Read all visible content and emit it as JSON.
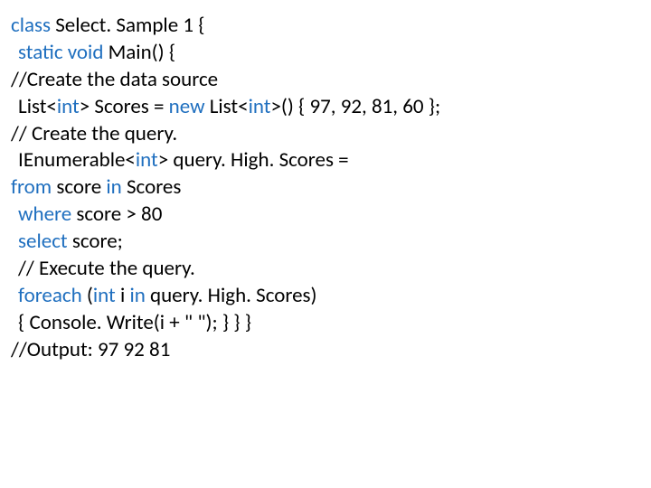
{
  "lines": [
    {
      "indent": 0,
      "tokens": [
        {
          "t": "class ",
          "c": "kw"
        },
        {
          "t": "Select. Sample 1 {",
          "c": "txt"
        }
      ]
    },
    {
      "indent": 1,
      "tokens": [
        {
          "t": "static void ",
          "c": "kw"
        },
        {
          "t": "Main() {",
          "c": "txt"
        }
      ]
    },
    {
      "indent": 0,
      "tokens": [
        {
          "t": "//Create the data source",
          "c": "txt"
        }
      ]
    },
    {
      "indent": 1,
      "tokens": [
        {
          "t": "List<",
          "c": "txt"
        },
        {
          "t": "int",
          "c": "kw"
        },
        {
          "t": "> Scores = ",
          "c": "txt"
        },
        {
          "t": "new ",
          "c": "kw"
        },
        {
          "t": "List<",
          "c": "txt"
        },
        {
          "t": "int",
          "c": "kw"
        },
        {
          "t": ">() { 97, 92, 81, 60 };",
          "c": "txt"
        }
      ]
    },
    {
      "indent": 0,
      "tokens": [
        {
          "t": "// Create the query.",
          "c": "txt"
        }
      ]
    },
    {
      "indent": 1,
      "tokens": [
        {
          "t": "IEnumerable<",
          "c": "txt"
        },
        {
          "t": "int",
          "c": "kw"
        },
        {
          "t": "> query. High. Scores =",
          "c": "txt"
        }
      ]
    },
    {
      "indent": 0,
      "tokens": [
        {
          "t": "from ",
          "c": "kw"
        },
        {
          "t": "score ",
          "c": "txt"
        },
        {
          "t": "in ",
          "c": "kw"
        },
        {
          "t": "Scores",
          "c": "txt"
        }
      ]
    },
    {
      "indent": 1,
      "tokens": [
        {
          "t": "where ",
          "c": "kw"
        },
        {
          "t": "score > 80",
          "c": "txt"
        }
      ]
    },
    {
      "indent": 1,
      "tokens": [
        {
          "t": "select ",
          "c": "kw"
        },
        {
          "t": "score;",
          "c": "txt"
        }
      ]
    },
    {
      "indent": 1,
      "tokens": [
        {
          "t": "// Execute the query.",
          "c": "txt"
        }
      ]
    },
    {
      "indent": 1,
      "tokens": [
        {
          "t": "foreach ",
          "c": "kw"
        },
        {
          "t": "(",
          "c": "txt"
        },
        {
          "t": "int ",
          "c": "kw"
        },
        {
          "t": "i ",
          "c": "txt"
        },
        {
          "t": "in ",
          "c": "kw"
        },
        {
          "t": "query. High. Scores)",
          "c": "txt"
        }
      ]
    },
    {
      "indent": 1,
      "tokens": [
        {
          "t": "{ Console. Write(i + \" \"); } } }",
          "c": "txt"
        }
      ]
    },
    {
      "indent": 0,
      "tokens": [
        {
          "t": "//Output: 97 92 81",
          "c": "txt"
        }
      ]
    }
  ]
}
